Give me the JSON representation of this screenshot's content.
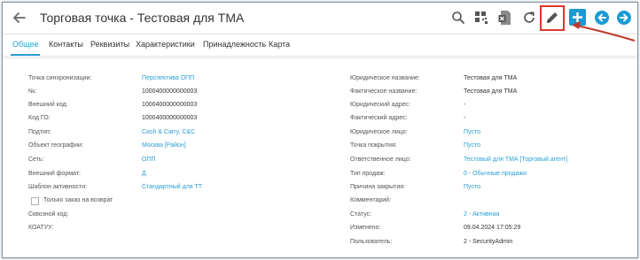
{
  "header": {
    "title": "Торговая точка - Тестовая для ТМА"
  },
  "tabs": [
    {
      "label": "Общее"
    },
    {
      "label": "Контакты"
    },
    {
      "label": "Реквизиты"
    },
    {
      "label": "Характеристики"
    },
    {
      "label": "Принадлежность"
    },
    {
      "label": "Карта"
    }
  ],
  "left_fields": [
    {
      "label": "Точка синхронизации:",
      "value": "Перспектива ОПП"
    },
    {
      "label": "№:",
      "value": "1000400000000003"
    },
    {
      "label": "Внешний код:",
      "value": "1000400000000003"
    },
    {
      "label": "Код ГО:",
      "value": "1000400000000003"
    },
    {
      "label": "Подтип:",
      "value": "Cash & Carry, C&C"
    },
    {
      "label": "Объект географии:",
      "value": "Москва [Район]"
    },
    {
      "label": "Сеть:",
      "value": "ОПП"
    },
    {
      "label": "Внешний формат:",
      "value": "Д"
    },
    {
      "label": "Шаблон активности:",
      "value": "Стандартный для ТТ"
    }
  ],
  "checkbox_label": "Только заказ на возврат",
  "left_extra": [
    {
      "label": "Сквозной код:"
    },
    {
      "label": "КОАТУУ:"
    }
  ],
  "right_fields": [
    {
      "label": "Юридическое название:",
      "value": "Тестовая для ТМА"
    },
    {
      "label": "Фактическое название:",
      "value": "Тестовая для ТМА"
    },
    {
      "label": "Юридический адрес:",
      "value": "-"
    },
    {
      "label": "Фактический адрес:",
      "value": "-"
    },
    {
      "label": "Юридическое лицо:",
      "value": "Пусто"
    },
    {
      "label": "Точка покрытия:",
      "value": "Пусто"
    },
    {
      "label": "Ответственное лицо:",
      "value": "Тестовый для ТМА [Торговый агент]"
    },
    {
      "label": "Тип продаж:",
      "value": "0 - Обычные продажи"
    },
    {
      "label": "Причина закрытия:",
      "value": "Пусто"
    },
    {
      "label": "Комментарий:",
      "value": ""
    },
    {
      "label": "Статус:",
      "value": "2 - Активная"
    },
    {
      "label": "Изменено:",
      "value": "09.04.2024 17:05:29"
    },
    {
      "label": "Пользователь:",
      "value": "2 - SecurityAdmin"
    }
  ],
  "colors": {
    "accent": "#2b9fd6",
    "highlight": "#d9382f",
    "add_button": "#1a9bd4"
  },
  "icons": [
    "back-arrow-icon",
    "search-icon",
    "barcode-grid-icon",
    "excel-icon",
    "refresh-icon",
    "edit-pencil-icon",
    "add-icon",
    "nav-prev-icon",
    "nav-next-icon"
  ]
}
